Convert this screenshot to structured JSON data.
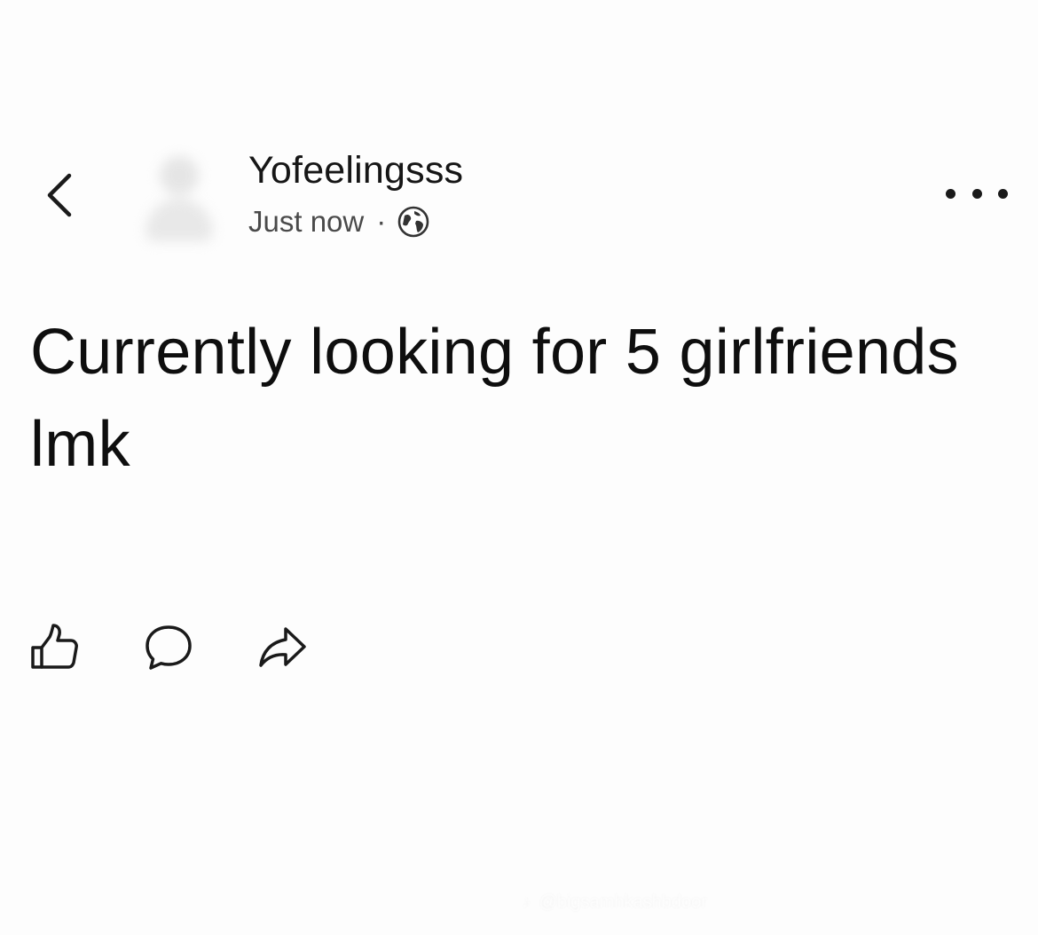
{
  "header": {
    "back_icon": "chevron-left-icon",
    "username": "Yofeelingsss",
    "timestamp": "Just now",
    "separator": "·",
    "privacy_icon": "globe-icon",
    "more_icon": "more-horizontal-icon"
  },
  "post": {
    "text": "Currently looking for 5 girlfriends lmk"
  },
  "actions": [
    {
      "icon": "thumbs-up-icon"
    },
    {
      "icon": "comment-icon"
    },
    {
      "icon": "share-icon"
    }
  ],
  "watermark": {
    "icon": "tiktok-icon",
    "handle": "@bigsamhkashbdoor"
  },
  "colors": {
    "background": "#fdfdfd",
    "text": "#111111",
    "secondary_text": "#4a4a4a"
  }
}
